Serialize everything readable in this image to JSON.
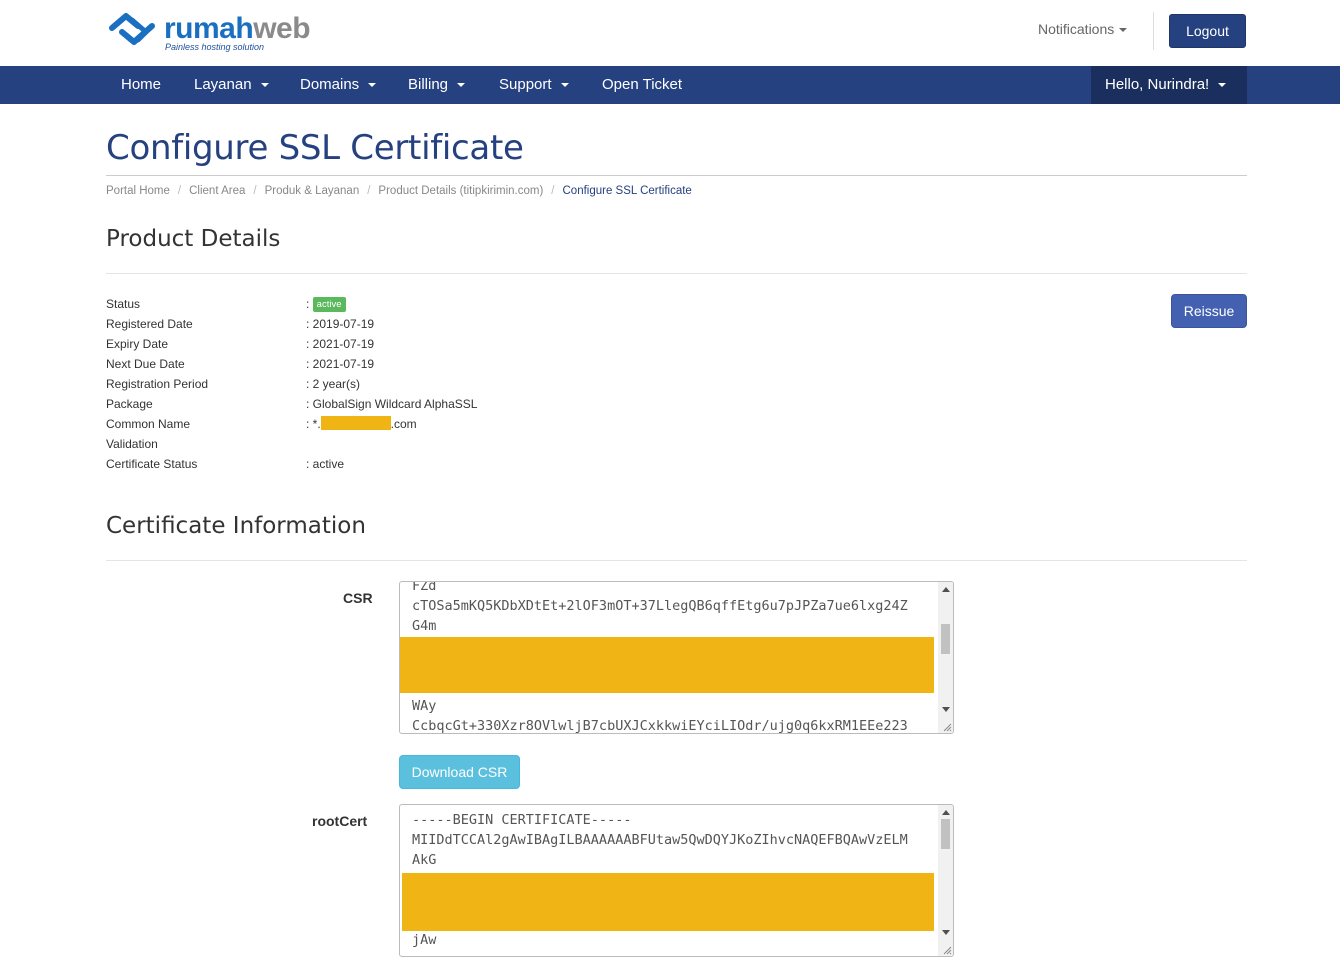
{
  "header": {
    "logo": {
      "name_part1": "rumah",
      "name_part2": "web",
      "tagline": "Painless hosting solution",
      "icon": "rumahweb-logo-icon"
    },
    "notifications_label": "Notifications",
    "logout_label": "Logout"
  },
  "nav": {
    "items": [
      {
        "label": "Home",
        "dropdown": false
      },
      {
        "label": "Layanan",
        "dropdown": true
      },
      {
        "label": "Domains",
        "dropdown": true
      },
      {
        "label": "Billing",
        "dropdown": true
      },
      {
        "label": "Support",
        "dropdown": true
      },
      {
        "label": "Open Ticket",
        "dropdown": false
      }
    ],
    "user_label": "Hello, Nurindra!"
  },
  "page": {
    "title": "Configure SSL Certificate",
    "breadcrumb": [
      "Portal Home",
      "Client Area",
      "Produk & Layanan",
      "Product Details (titipkirimin.com)",
      "Configure SSL Certificate"
    ]
  },
  "product_details": {
    "heading": "Product Details",
    "reissue_label": "Reissue",
    "rows": [
      {
        "label": "Status",
        "value": "",
        "badge": "active"
      },
      {
        "label": "Registered Date",
        "value": ": 2019-07-19"
      },
      {
        "label": "Expiry Date",
        "value": ": 2021-07-19"
      },
      {
        "label": "Next Due Date",
        "value": ": 2021-07-19"
      },
      {
        "label": "Registration Period",
        "value": ": 2 year(s)"
      },
      {
        "label": "Package",
        "value": ": GlobalSign Wildcard AlphaSSL"
      },
      {
        "label": "Common Name",
        "value_prefix": ": *.",
        "value_suffix": ".com",
        "redacted": true
      },
      {
        "label": "Validation",
        "value": ""
      },
      {
        "label": "Certificate Status",
        "value": ": active"
      }
    ]
  },
  "certificate_info": {
    "heading": "Certificate Information",
    "csr": {
      "label": "CSR",
      "lines": [
        "FZd",
        "cTOSa5mKQ5KDbXDtEt+2lOF3mOT+37LlegQB6qffEtg6u7pJPZa7ue6lxg24Z",
        "G4m",
        "",
        "",
        "",
        "WAy",
        "CcbqcGt+330Xzr8OVlwljB7cbUXJCxkkwiEYciLIOdr/ujg0q6kxRM1EEe223"
      ],
      "download_label": "Download CSR"
    },
    "root_cert": {
      "label": "rootCert",
      "lines": [
        "-----BEGIN CERTIFICATE-----",
        "MIIDdTCCAl2gAwIBAgILBAAAAAABFUtaw5QwDQYJKoZIhvcNAQEFBQAwVzELM",
        "AkG",
        "",
        "",
        "",
        "jAw"
      ]
    },
    "redaction_color": "#f0b415"
  },
  "colors": {
    "brand_navy": "#254180",
    "nav_user_bg": "#1b2f5e",
    "reissue_blue": "#4361b0",
    "download_info": "#5bc0de",
    "badge_green": "#5cb85c"
  }
}
